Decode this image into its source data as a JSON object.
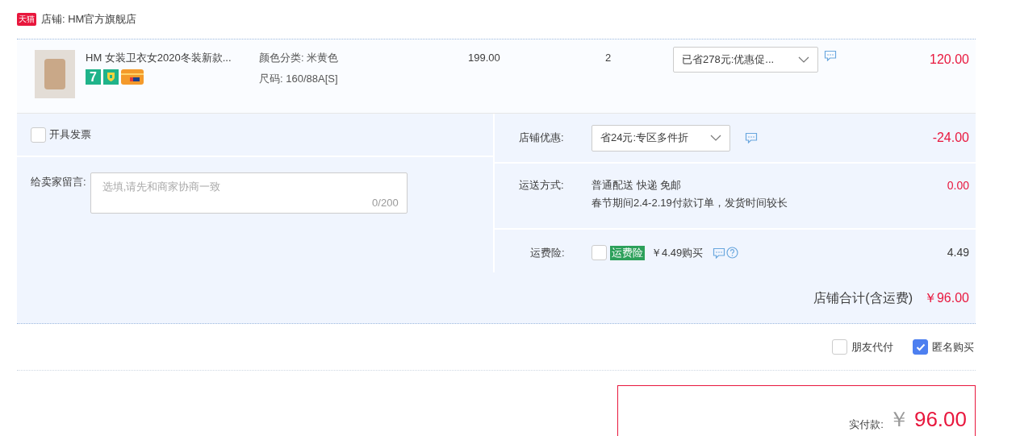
{
  "shop": {
    "badge": "天猫",
    "label": "店铺: HM官方旗舰店"
  },
  "item": {
    "title": "HM 女装卫衣女2020冬装新款...",
    "services": [
      {
        "kind": "seven",
        "label": "7"
      },
      {
        "kind": "guarantee"
      },
      {
        "kind": "card"
      }
    ],
    "props": [
      "颜色分类: 米黄色",
      "尺码: 160/88A[S]"
    ],
    "price": "199.00",
    "quantity": "2",
    "promo": "已省278元:优惠促...",
    "subtotal": "120.00"
  },
  "invoice": {
    "label": "开具发票",
    "checked": false
  },
  "message": {
    "label": "给卖家留言:",
    "placeholder": "选填,请先和商家协商一致",
    "counter": "0/200"
  },
  "discount": {
    "label": "店铺优惠:",
    "select": "省24元:专区多件折",
    "amount": "-24.00"
  },
  "shipping": {
    "label": "运送方式:",
    "lines": [
      "普通配送 快递 免邮",
      "春节期间2.4-2.19付款订单，发货时间较长"
    ],
    "amount": "0.00"
  },
  "insurance": {
    "label": "运费险:",
    "checked": false,
    "tag": "运费险",
    "price": "￥4.49购买",
    "amount": "4.49"
  },
  "total": {
    "label": "店铺合计(含运费)",
    "amount": "￥96.00"
  },
  "options": [
    {
      "label": "朋友代付",
      "checked": false
    },
    {
      "label": "匿名购买",
      "checked": true
    }
  ],
  "pay": {
    "label": "实付款:",
    "currency": "￥",
    "amount": "96.00"
  }
}
